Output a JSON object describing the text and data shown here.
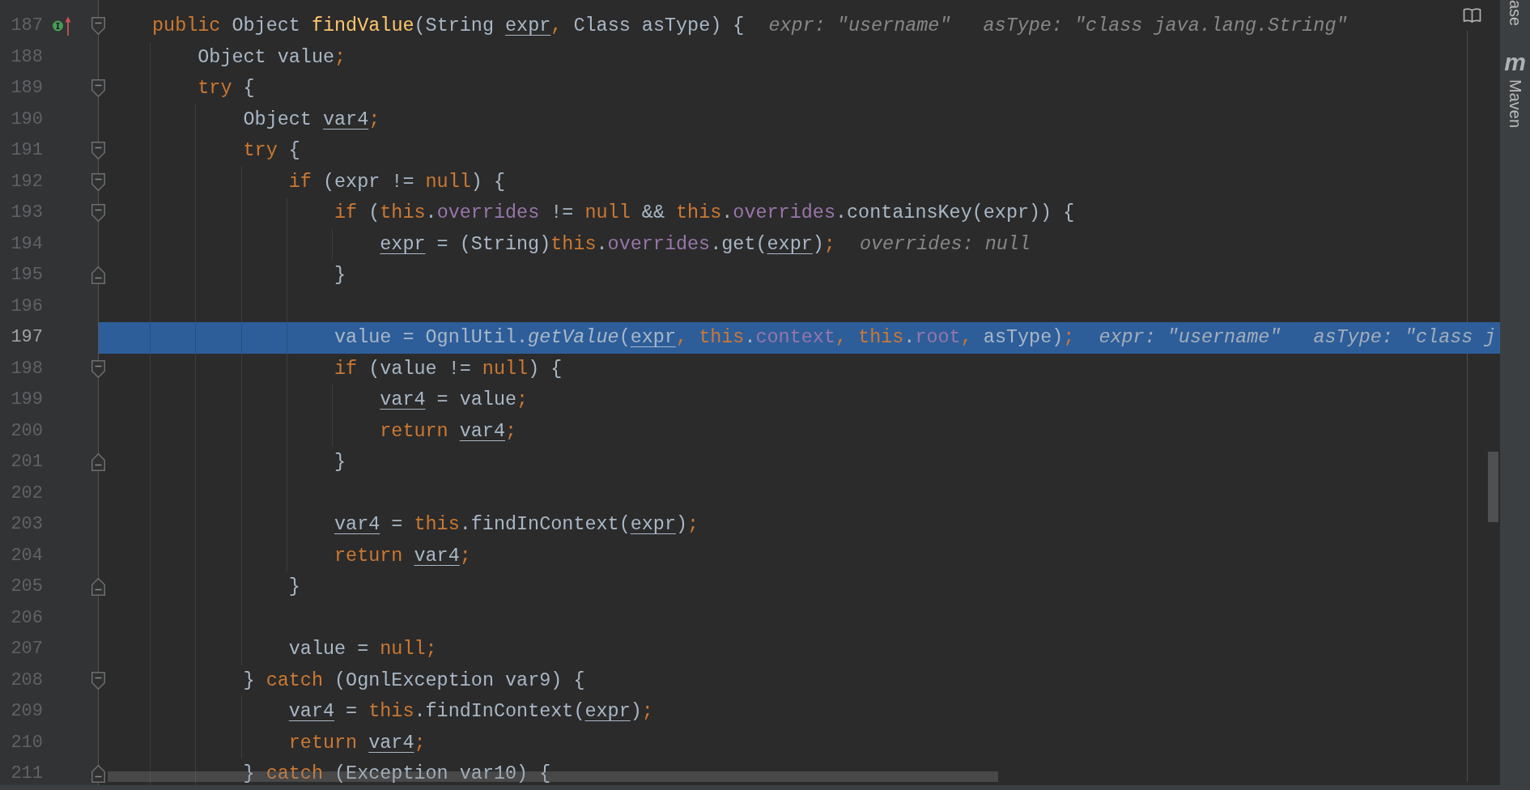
{
  "editor": {
    "lines": [
      {
        "number": "187",
        "current": false,
        "kind": "opener",
        "implements": true,
        "tokens": [
          {
            "text": "public",
            "kind": "keyword"
          },
          {
            "text": " Object ",
            "kind": "plain"
          },
          {
            "text": "findValue",
            "kind": "method_decl"
          },
          {
            "text": "(String ",
            "kind": "plain"
          },
          {
            "text": "expr",
            "kind": "reassigned"
          },
          {
            "text": ",",
            "kind": "keyword"
          },
          {
            "text": " Class asType) {",
            "kind": "plain"
          }
        ],
        "hints": [
          "expr: \"username\"",
          "asType: \"class java.lang.String\""
        ],
        "children": [
          {
            "number": "188",
            "current": false,
            "implements": false,
            "tokens": [
              {
                "text": "Object value",
                "kind": "plain"
              },
              {
                "text": ";",
                "kind": "keyword"
              }
            ]
          },
          {
            "number": "189",
            "current": false,
            "kind": "opener",
            "implements": false,
            "tokens": [
              {
                "text": "try",
                "kind": "keyword"
              },
              {
                "text": " {",
                "kind": "plain"
              }
            ],
            "children": [
              {
                "number": "190",
                "current": false,
                "implements": false,
                "tokens": [
                  {
                    "text": "Object ",
                    "kind": "plain"
                  },
                  {
                    "text": "var4",
                    "kind": "reassigned"
                  },
                  {
                    "text": ";",
                    "kind": "keyword"
                  }
                ]
              },
              {
                "number": "191",
                "current": false,
                "kind": "opener",
                "implements": false,
                "tokens": [
                  {
                    "text": "try",
                    "kind": "keyword"
                  },
                  {
                    "text": " {",
                    "kind": "plain"
                  }
                ],
                "children": [
                  {
                    "number": "192",
                    "current": false,
                    "kind": "opener",
                    "implements": false,
                    "tokens": [
                      {
                        "text": "if",
                        "kind": "keyword"
                      },
                      {
                        "text": " (expr != ",
                        "kind": "plain"
                      },
                      {
                        "text": "null",
                        "kind": "keyword"
                      },
                      {
                        "text": ") {",
                        "kind": "plain"
                      }
                    ],
                    "children": [
                      {
                        "number": "193",
                        "current": false,
                        "kind": "opener",
                        "implements": false,
                        "tokens": [
                          {
                            "text": "if",
                            "kind": "keyword"
                          },
                          {
                            "text": " (",
                            "kind": "plain"
                          },
                          {
                            "text": "this",
                            "kind": "keyword"
                          },
                          {
                            "text": ".",
                            "kind": "plain"
                          },
                          {
                            "text": "overrides",
                            "kind": "field"
                          },
                          {
                            "text": " != ",
                            "kind": "plain"
                          },
                          {
                            "text": "null",
                            "kind": "keyword"
                          },
                          {
                            "text": " && ",
                            "kind": "plain"
                          },
                          {
                            "text": "this",
                            "kind": "keyword"
                          },
                          {
                            "text": ".",
                            "kind": "plain"
                          },
                          {
                            "text": "overrides",
                            "kind": "field"
                          },
                          {
                            "text": ".containsKey(expr)) {",
                            "kind": "plain"
                          }
                        ],
                        "children": [
                          {
                            "number": "194",
                            "current": false,
                            "implements": false,
                            "tokens": [
                              {
                                "text": "expr",
                                "kind": "reassigned"
                              },
                              {
                                "text": " = (String)",
                                "kind": "plain"
                              },
                              {
                                "text": "this",
                                "kind": "keyword"
                              },
                              {
                                "text": ".",
                                "kind": "plain"
                              },
                              {
                                "text": "overrides",
                                "kind": "field"
                              },
                              {
                                "text": ".get(",
                                "kind": "plain"
                              },
                              {
                                "text": "expr",
                                "kind": "reassigned"
                              },
                              {
                                "text": ")",
                                "kind": "plain"
                              },
                              {
                                "text": ";",
                                "kind": "keyword"
                              }
                            ],
                            "hints": [
                              "overrides: null"
                            ]
                          }
                        ]
                      },
                      {
                        "number": "195",
                        "current": false,
                        "kind": "closer",
                        "implements": false,
                        "tokens": [
                          {
                            "text": "}",
                            "kind": "plain"
                          }
                        ]
                      },
                      {
                        "number": "196",
                        "current": false,
                        "implements": false
                      },
                      {
                        "number": "197",
                        "current": true,
                        "implements": false,
                        "tokens": [
                          {
                            "text": "value = OgnlUtil.",
                            "kind": "plain"
                          },
                          {
                            "text": "getValue",
                            "kind": "static_call"
                          },
                          {
                            "text": "(",
                            "kind": "plain"
                          },
                          {
                            "text": "expr",
                            "kind": "reassigned"
                          },
                          {
                            "text": ", ",
                            "kind": "keyword"
                          },
                          {
                            "text": "this",
                            "kind": "keyword"
                          },
                          {
                            "text": ".",
                            "kind": "plain"
                          },
                          {
                            "text": "context",
                            "kind": "field"
                          },
                          {
                            "text": ", ",
                            "kind": "keyword"
                          },
                          {
                            "text": "this",
                            "kind": "keyword"
                          },
                          {
                            "text": ".",
                            "kind": "plain"
                          },
                          {
                            "text": "root",
                            "kind": "field"
                          },
                          {
                            "text": ", ",
                            "kind": "keyword"
                          },
                          {
                            "text": "asType)",
                            "kind": "plain"
                          },
                          {
                            "text": ";",
                            "kind": "keyword"
                          }
                        ],
                        "hints": [
                          "expr: \"username\"",
                          "asType: \"class j"
                        ]
                      },
                      {
                        "number": "198",
                        "current": false,
                        "kind": "opener",
                        "implements": false,
                        "tokens": [
                          {
                            "text": "if",
                            "kind": "keyword"
                          },
                          {
                            "text": " (value != ",
                            "kind": "plain"
                          },
                          {
                            "text": "null",
                            "kind": "keyword"
                          },
                          {
                            "text": ") {",
                            "kind": "plain"
                          }
                        ],
                        "children": [
                          {
                            "number": "199",
                            "current": false,
                            "implements": false,
                            "tokens": [
                              {
                                "text": "var4",
                                "kind": "reassigned"
                              },
                              {
                                "text": " = value",
                                "kind": "plain"
                              },
                              {
                                "text": ";",
                                "kind": "keyword"
                              }
                            ]
                          },
                          {
                            "number": "200",
                            "current": false,
                            "implements": false,
                            "tokens": [
                              {
                                "text": "return ",
                                "kind": "keyword"
                              },
                              {
                                "text": "var4",
                                "kind": "reassigned"
                              },
                              {
                                "text": ";",
                                "kind": "keyword"
                              }
                            ]
                          }
                        ]
                      },
                      {
                        "number": "201",
                        "current": false,
                        "kind": "closer",
                        "implements": false,
                        "tokens": [
                          {
                            "text": "}",
                            "kind": "plain"
                          }
                        ]
                      },
                      {
                        "number": "202",
                        "current": false,
                        "implements": false
                      },
                      {
                        "number": "203",
                        "current": false,
                        "implements": false,
                        "tokens": [
                          {
                            "text": "var4",
                            "kind": "reassigned"
                          },
                          {
                            "text": " = ",
                            "kind": "plain"
                          },
                          {
                            "text": "this",
                            "kind": "keyword"
                          },
                          {
                            "text": ".findInContext(",
                            "kind": "plain"
                          },
                          {
                            "text": "expr",
                            "kind": "reassigned"
                          },
                          {
                            "text": ")",
                            "kind": "plain"
                          },
                          {
                            "text": ";",
                            "kind": "keyword"
                          }
                        ]
                      },
                      {
                        "number": "204",
                        "current": false,
                        "implements": false,
                        "tokens": [
                          {
                            "text": "return ",
                            "kind": "keyword"
                          },
                          {
                            "text": "var4",
                            "kind": "reassigned"
                          },
                          {
                            "text": ";",
                            "kind": "keyword"
                          }
                        ]
                      }
                    ]
                  },
                  {
                    "number": "205",
                    "current": false,
                    "kind": "closer",
                    "implements": false,
                    "tokens": [
                      {
                        "text": "}",
                        "kind": "plain"
                      }
                    ]
                  },
                  {
                    "number": "206",
                    "current": false,
                    "implements": false
                  },
                  {
                    "number": "207",
                    "current": false,
                    "implements": false,
                    "tokens": [
                      {
                        "text": "value = ",
                        "kind": "plain"
                      },
                      {
                        "text": "null",
                        "kind": "keyword"
                      },
                      {
                        "text": ";",
                        "kind": "keyword"
                      }
                    ]
                  }
                ]
              },
              {
                "number": "208",
                "current": false,
                "kind": "opener",
                "implements": false,
                "tokens": [
                  {
                    "text": "} ",
                    "kind": "plain"
                  },
                  {
                    "text": "catch",
                    "kind": "keyword"
                  },
                  {
                    "text": " (OgnlException var9) {",
                    "kind": "plain"
                  }
                ],
                "children": [
                  {
                    "number": "209",
                    "current": false,
                    "implements": false,
                    "tokens": [
                      {
                        "text": "var4",
                        "kind": "reassigned"
                      },
                      {
                        "text": " = ",
                        "kind": "plain"
                      },
                      {
                        "text": "this",
                        "kind": "keyword"
                      },
                      {
                        "text": ".findInContext(",
                        "kind": "plain"
                      },
                      {
                        "text": "expr",
                        "kind": "reassigned"
                      },
                      {
                        "text": ")",
                        "kind": "plain"
                      },
                      {
                        "text": ";",
                        "kind": "keyword"
                      }
                    ]
                  },
                  {
                    "number": "210",
                    "current": false,
                    "implements": false,
                    "tokens": [
                      {
                        "text": "return ",
                        "kind": "keyword"
                      },
                      {
                        "text": "var4",
                        "kind": "reassigned"
                      },
                      {
                        "text": ";",
                        "kind": "keyword"
                      }
                    ]
                  }
                ]
              },
              {
                "number": "211",
                "current": false,
                "kind": "closer",
                "implements": false,
                "tokens": [
                  {
                    "text": "} ",
                    "kind": "plain"
                  },
                  {
                    "text": "catch",
                    "kind": "keyword"
                  },
                  {
                    "text": " (Exception var10) {",
                    "kind": "plain"
                  }
                ]
              }
            ]
          }
        ]
      }
    ]
  },
  "tool_strip": {
    "buttons": [
      {
        "label": "ase"
      },
      {
        "label": "Maven",
        "glyph": "m"
      }
    ]
  }
}
